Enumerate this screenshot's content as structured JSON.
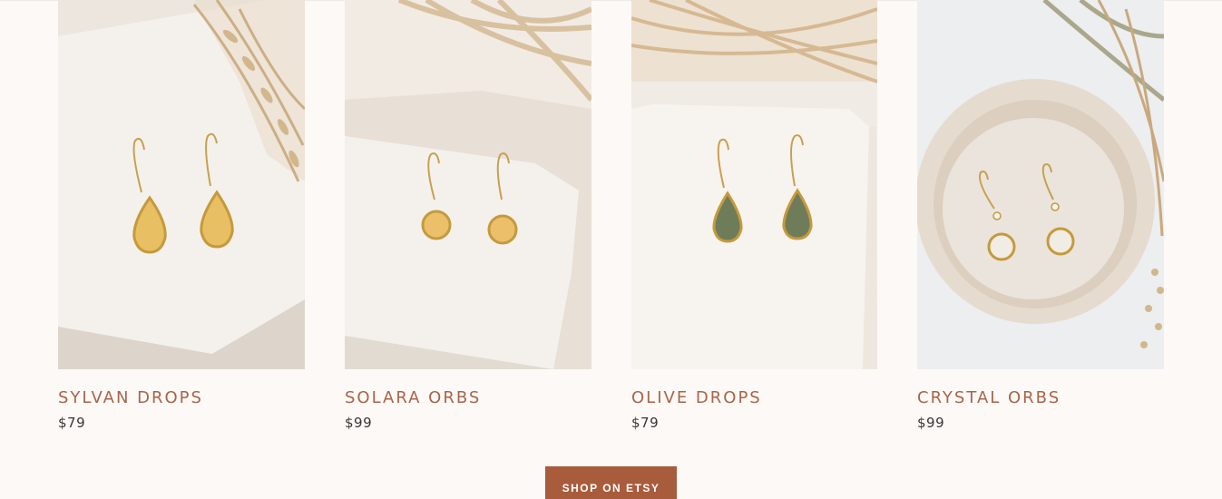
{
  "products": [
    {
      "title": "SYLVAN DROPS",
      "price": "$79",
      "stone_color": "#e9bf64"
    },
    {
      "title": "SOLARA ORBS",
      "price": "$99",
      "stone_color": "#ecc06a"
    },
    {
      "title": "OLIVE DROPS",
      "price": "$79",
      "stone_color": "#6f7c5a"
    },
    {
      "title": "CRYSTAL ORBS",
      "price": "$99",
      "stone_color": "#f1ede4"
    }
  ],
  "cta": {
    "label": "SHOP ON ETSY"
  },
  "colors": {
    "background": "#fdf9f6",
    "title": "#a8644a",
    "price": "#3b3634",
    "button": "#a85c3c"
  }
}
